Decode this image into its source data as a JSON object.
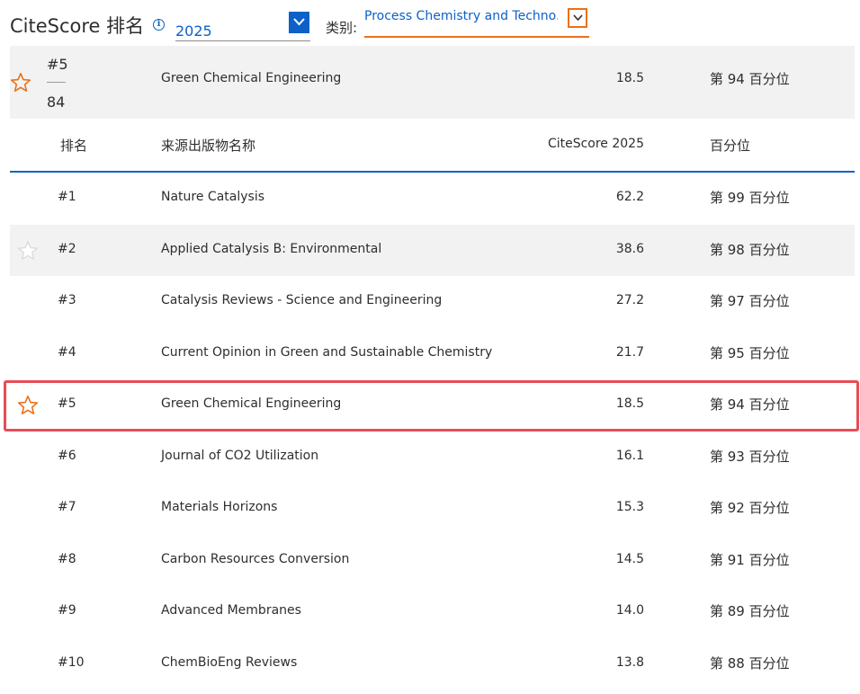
{
  "header": {
    "title": "CiteScore 排名",
    "info_icon": "info-circle-icon",
    "year": "2025",
    "category_label": "类别:",
    "category_value": "Process Chemistry and Techno..."
  },
  "summary": {
    "rank": "#5",
    "total": "84",
    "name": "Green Chemical Engineering",
    "score": "18.5",
    "percentile": "第 94 百分位",
    "starred": true
  },
  "table": {
    "headers": {
      "rank": "排名",
      "name": "来源出版物名称",
      "score": "CiteScore 2025",
      "percentile": "百分位"
    },
    "rows": [
      {
        "rank": "#1",
        "name": "Nature Catalysis",
        "score": "62.2",
        "percentile": "第 99 百分位",
        "star": "none"
      },
      {
        "rank": "#2",
        "name": "Applied Catalysis B: Environmental",
        "score": "38.6",
        "percentile": "第 98 百分位",
        "star": "hover"
      },
      {
        "rank": "#3",
        "name": "Catalysis Reviews - Science and Engineering",
        "score": "27.2",
        "percentile": "第 97 百分位",
        "star": "none"
      },
      {
        "rank": "#4",
        "name": "Current Opinion in Green and Sustainable Chemistry",
        "score": "21.7",
        "percentile": "第 95 百分位",
        "star": "none"
      },
      {
        "rank": "#5",
        "name": "Green Chemical Engineering",
        "score": "18.5",
        "percentile": "第 94 百分位",
        "star": "active"
      },
      {
        "rank": "#6",
        "name": "Journal of CO2 Utilization",
        "score": "16.1",
        "percentile": "第 93 百分位",
        "star": "none"
      },
      {
        "rank": "#7",
        "name": "Materials Horizons",
        "score": "15.3",
        "percentile": "第 92 百分位",
        "star": "none"
      },
      {
        "rank": "#8",
        "name": "Carbon Resources Conversion",
        "score": "14.5",
        "percentile": "第 91 百分位",
        "star": "none"
      },
      {
        "rank": "#9",
        "name": "Advanced Membranes",
        "score": "14.0",
        "percentile": "第 89 百分位",
        "star": "none"
      },
      {
        "rank": "#10",
        "name": "ChemBioEng Reviews",
        "score": "13.8",
        "percentile": "第 88 百分位",
        "star": "none"
      }
    ]
  },
  "colors": {
    "accent": "#0c61c9",
    "star_active": "#e9711c",
    "star_hover": "#dcdcdc",
    "highlight_border": "#e84c55",
    "row_shade": "#f2f2f2"
  }
}
